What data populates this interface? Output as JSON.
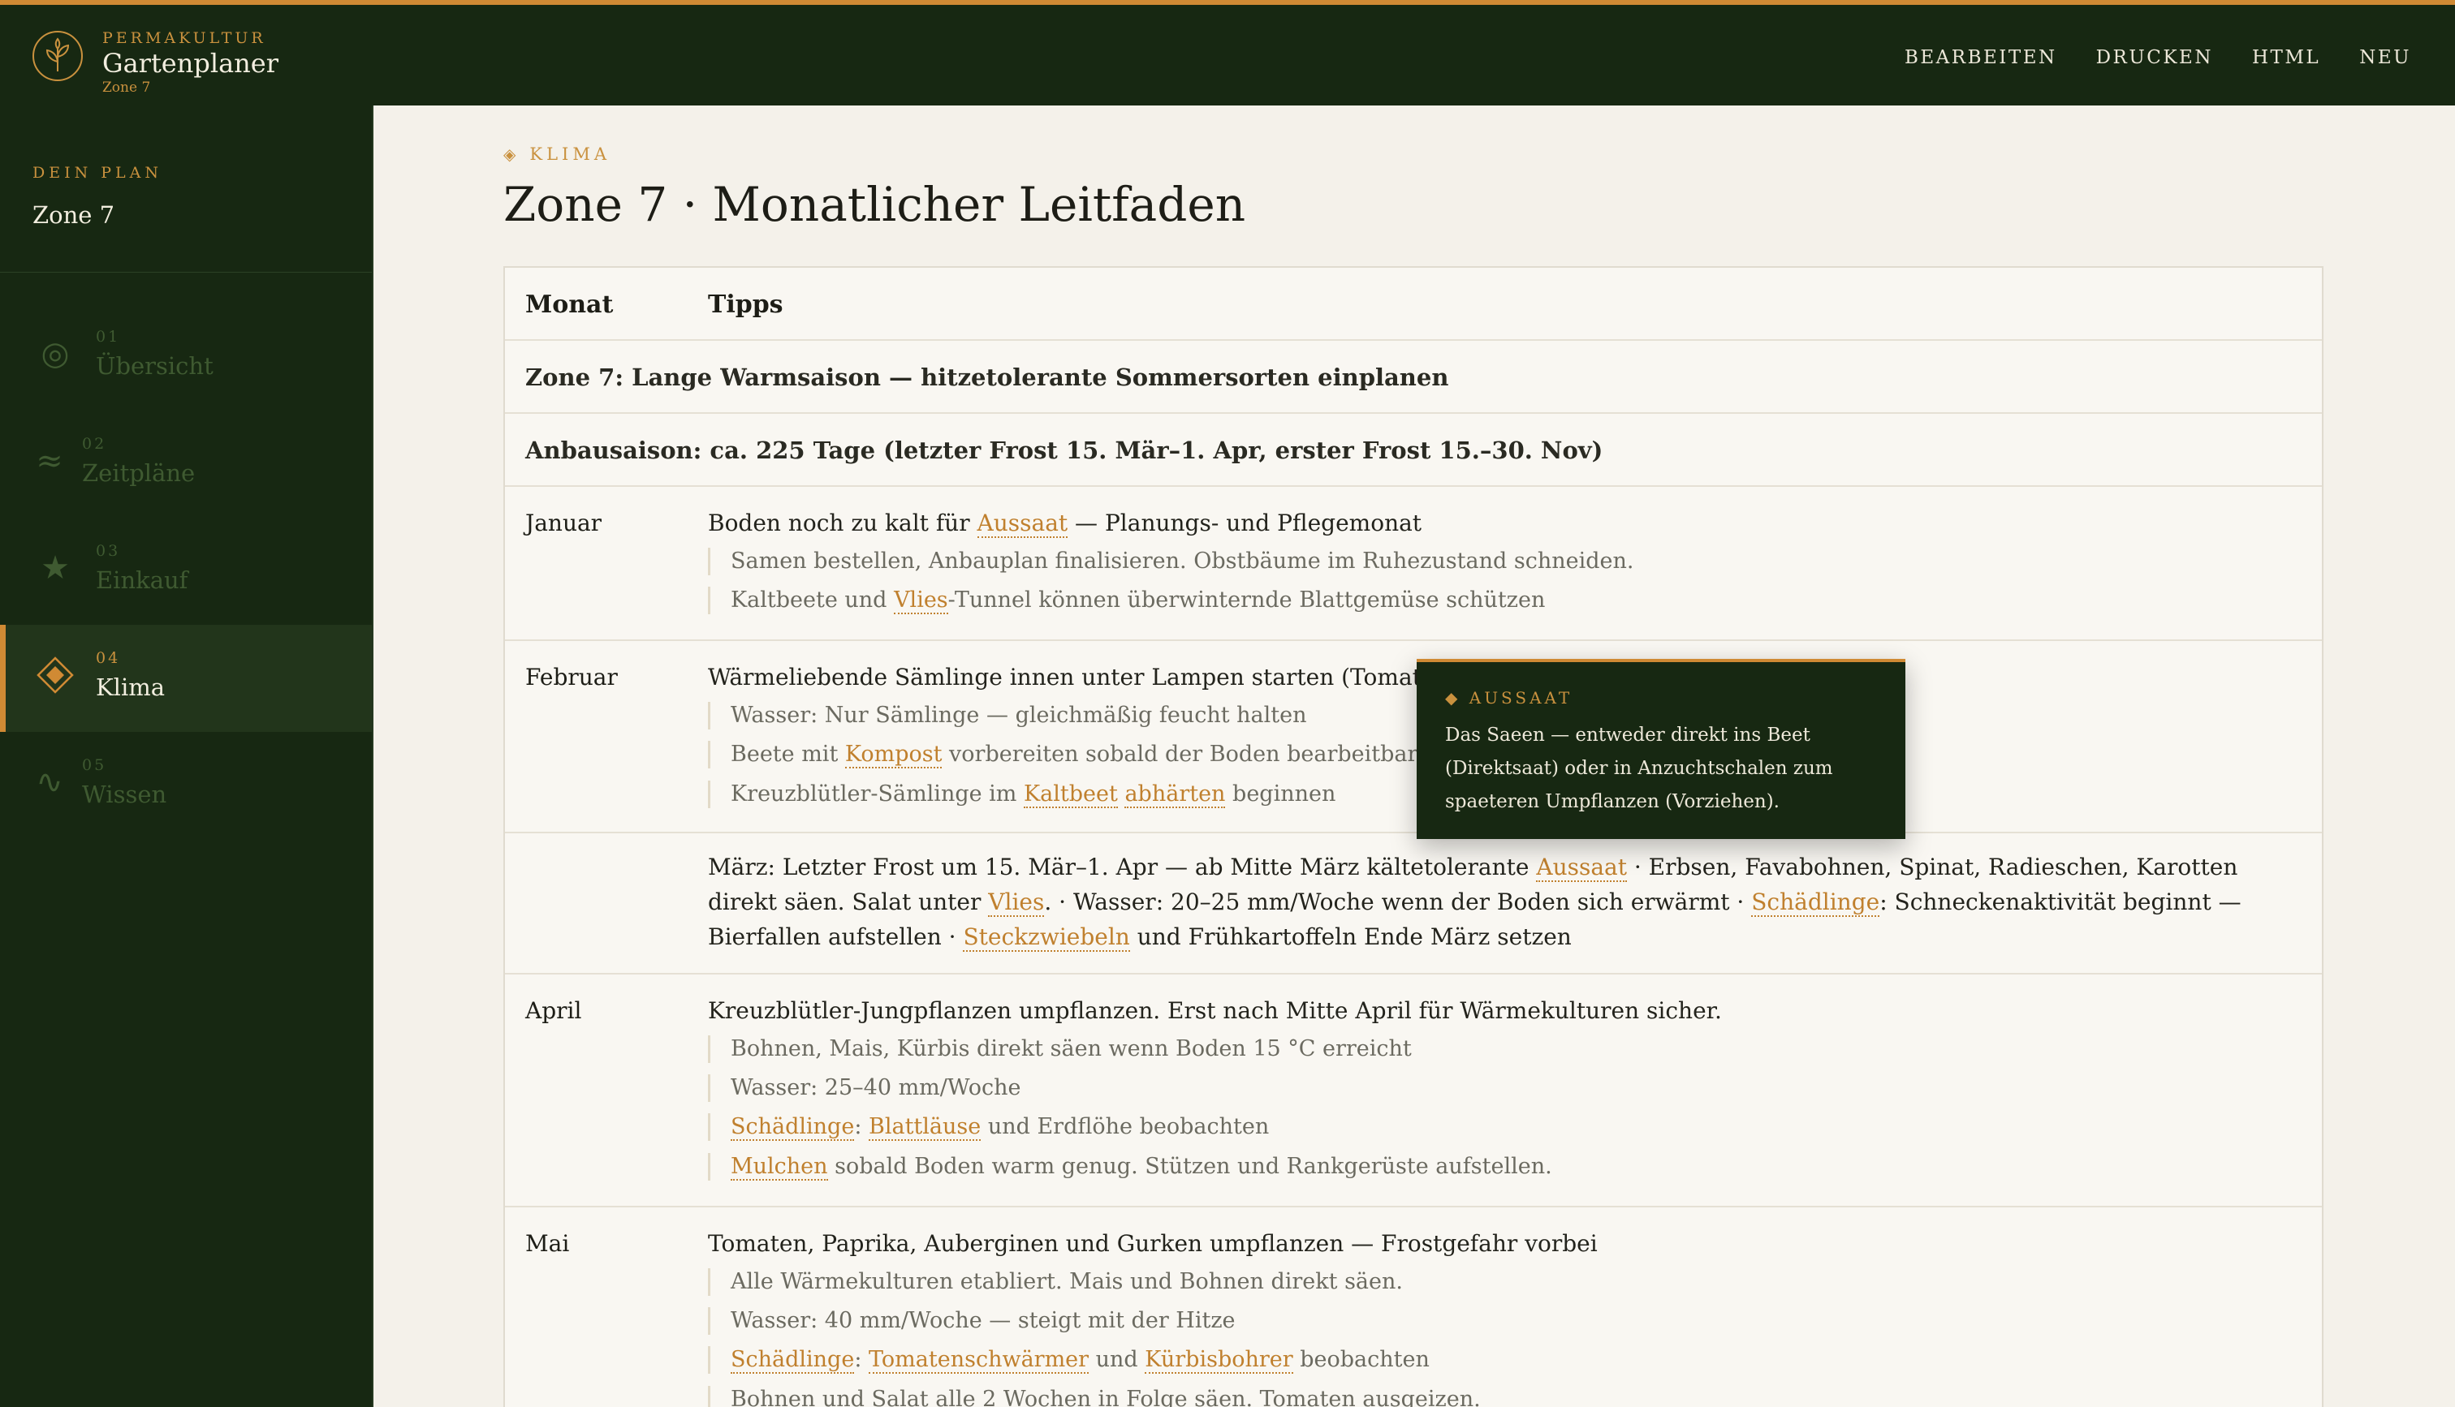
{
  "colors": {
    "accent": "#d08a34",
    "sidebar_bg": "#172812",
    "page_bg": "#f4f1ea",
    "keyword": "#c0802e"
  },
  "header": {
    "kicker": "PERMAKULTUR",
    "title": "Gartenplaner",
    "subtitle": "Zone 7",
    "logo_icon": "leaf-spiral-icon",
    "nav": [
      "BEARBEITEN",
      "DRUCKEN",
      "HTML",
      "NEU"
    ]
  },
  "sidebar": {
    "plan_label": "DEIN PLAN",
    "plan_value": "Zone 7",
    "items": [
      {
        "num": "01",
        "label": "Übersicht",
        "icon": "target-icon",
        "glyph": "◎"
      },
      {
        "num": "02",
        "label": "Zeitpläne",
        "icon": "waves-icon",
        "glyph": "≈"
      },
      {
        "num": "03",
        "label": "Einkauf",
        "icon": "star-icon",
        "glyph": "★"
      },
      {
        "num": "04",
        "label": "Klima",
        "icon": "diamond-icon",
        "glyph": "◈"
      },
      {
        "num": "05",
        "label": "Wissen",
        "icon": "tilde-icon",
        "glyph": "∿"
      }
    ],
    "active": "Klima"
  },
  "main": {
    "kicker": "KLIMA",
    "kicker_glyph": "◈",
    "title": "Zone 7 · Monatlicher Leitfaden",
    "table": {
      "headers": [
        "Monat",
        "Tipps"
      ],
      "banners": [
        "Zone 7: Lange Warmsaison — hitzetolerante Sommersorten einplanen",
        "Anbausaison: ca. 225 Tage (letzter Frost 15. Mär–1. Apr, erster Frost 15.–30. Nov)"
      ],
      "rows": {
        "jan": {
          "month": "Januar",
          "lead": [
            "Boden noch zu kalt für ",
            "Aussaat",
            " — Planungs- und Pflegemonat"
          ],
          "subs": [
            "Samen bestellen, Anbauplan finalisieren. Obstbäume im Ruhezustand schneiden.",
            [
              "Kaltbeete und ",
              "Vlies",
              "-Tunnel können überwinternde Blattgemüse schützen"
            ]
          ]
        },
        "feb": {
          "month": "Februar",
          "lead": "Wärmeliebende Sämlinge innen unter Lampen starten (Tomaten, Papr",
          "subs": [
            "Wasser: Nur Sämlinge — gleichmäßig feucht halten",
            [
              "Beete mit ",
              "Kompost",
              " vorbereiten sobald der Boden bearbeitbar ist. Saa"
            ],
            [
              "Kreuzblütler-Sämlinge im ",
              "Kaltbeet",
              " ",
              "abhärten",
              " beginnen"
            ]
          ]
        },
        "mar": {
          "para": [
            "März: Letzter Frost um 15. Mär–1. Apr — ab Mitte März kältetolerante ",
            "Aussaat",
            " · Erbsen, Favabohnen, Spinat, Radieschen, Karotten direkt säen. Salat unter ",
            "Vlies",
            ". · Wasser: 20–25 mm/Woche wenn der Boden sich erwärmt · ",
            "Schädlinge",
            ": Schneckenaktivität beginnt — Bierfallen aufstellen · ",
            "Steckzwiebeln",
            " und Frühkartoffeln Ende März setzen"
          ]
        },
        "apr": {
          "month": "April",
          "lead": "Kreuzblütler-Jungpflanzen umpflanzen. Erst nach Mitte April für Wärmekulturen sicher.",
          "subs": [
            "Bohnen, Mais, Kürbis direkt säen wenn Boden 15 °C erreicht",
            "Wasser: 25–40 mm/Woche",
            [
              "Schädlinge",
              ": ",
              "Blattläuse",
              " und Erdflöhe beobachten"
            ],
            [
              "Mulchen",
              " sobald Boden warm genug. Stützen und Rankgerüste aufstellen."
            ]
          ]
        },
        "mai": {
          "month": "Mai",
          "lead": "Tomaten, Paprika, Auberginen und Gurken umpflanzen — Frostgefahr vorbei",
          "subs": [
            "Alle Wärmekulturen etabliert. Mais und Bohnen direkt säen.",
            "Wasser: 40 mm/Woche — steigt mit der Hitze",
            [
              "Schädlinge",
              ": ",
              "Tomatenschwärmer",
              " und ",
              "Kürbisbohrer",
              " beobachten"
            ],
            "Bohnen und Salat alle 2 Wochen in Folge säen. Tomaten ausgeizen."
          ]
        }
      }
    },
    "tooltip": {
      "kicker": "AUSSAAT",
      "kicker_glyph": "◆",
      "body": "Das Saeen — entweder direkt ins Beet (Direktsaat) oder in Anzuchtschalen zum spaeteren Umpflanzen (Vorziehen)."
    }
  }
}
